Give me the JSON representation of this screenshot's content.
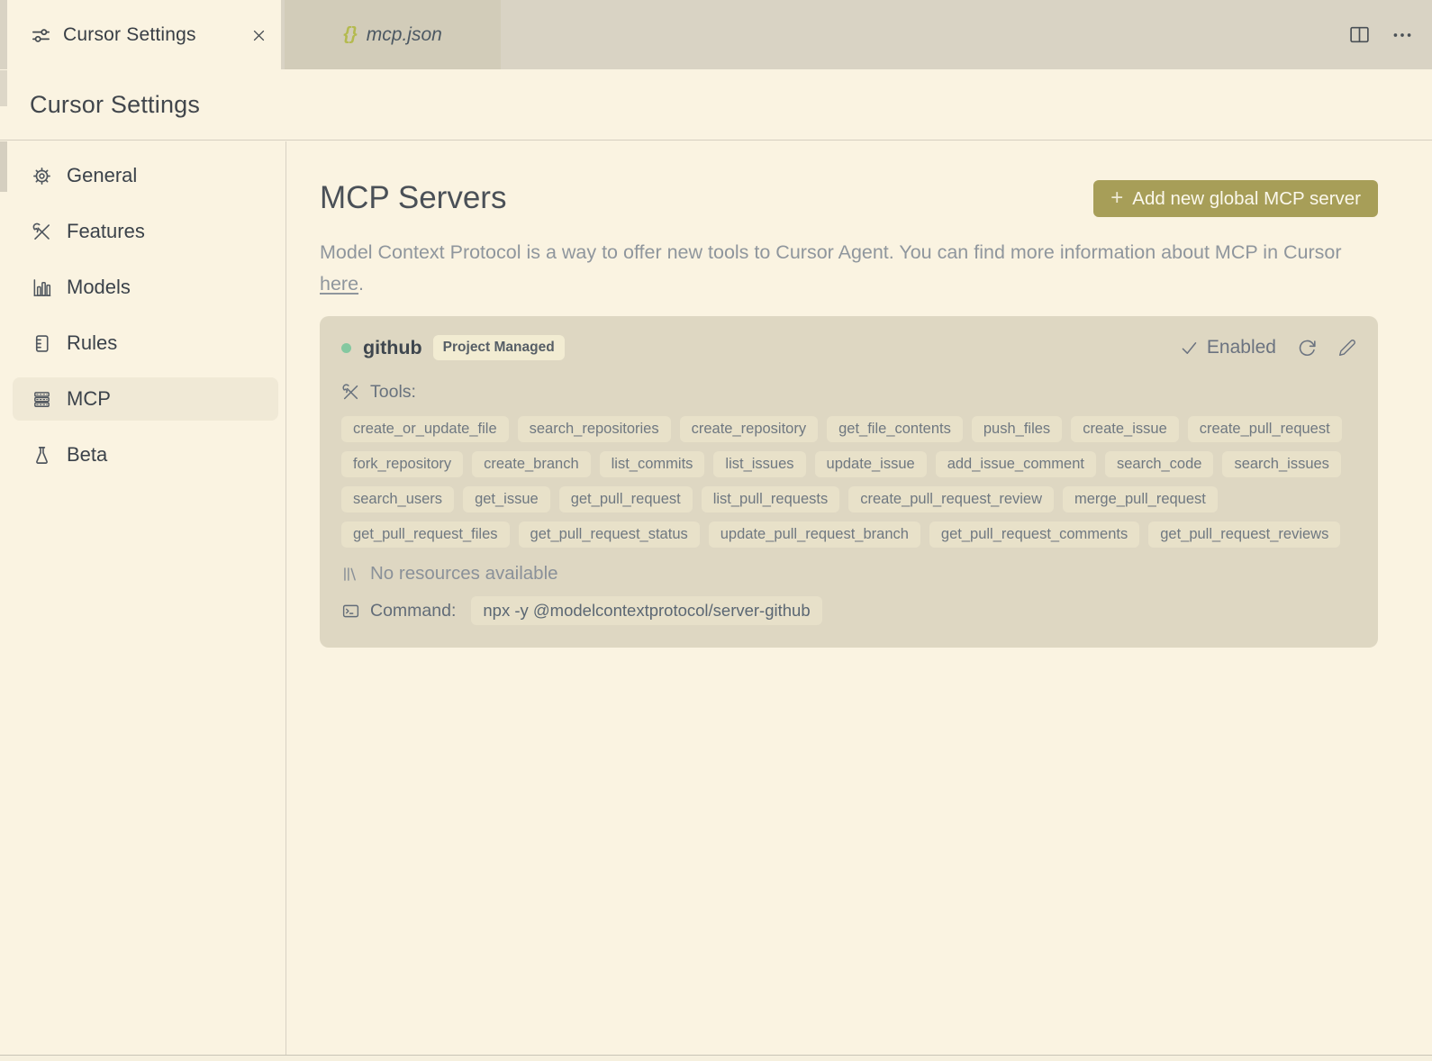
{
  "window": {
    "tabbar": {
      "active_tab": "Cursor Settings",
      "preview_tab": "mcp.json",
      "preview_tab_icon": "{}"
    }
  },
  "header": {
    "title": "Cursor Settings"
  },
  "sidebar": {
    "items": [
      {
        "label": "General",
        "icon": "gear-icon",
        "active": false
      },
      {
        "label": "Features",
        "icon": "tools-icon",
        "active": false
      },
      {
        "label": "Models",
        "icon": "bar-chart-icon",
        "active": false
      },
      {
        "label": "Rules",
        "icon": "ruler-icon",
        "active": false
      },
      {
        "label": "MCP",
        "icon": "server-stack-icon",
        "active": true
      },
      {
        "label": "Beta",
        "icon": "flask-icon",
        "active": false
      }
    ]
  },
  "main": {
    "title": "MCP Servers",
    "add_button": {
      "plus": "+",
      "label": "Add new global MCP server"
    },
    "description": {
      "before_link": "Model Context Protocol is a way to offer new tools to Cursor Agent. You can find more information about MCP in Cursor ",
      "link_label": "here",
      "after_link": "."
    },
    "server": {
      "name": "github",
      "badge": "Project Managed",
      "status_label": "Enabled",
      "tools_label": "Tools:",
      "tools": [
        "create_or_update_file",
        "search_repositories",
        "create_repository",
        "get_file_contents",
        "push_files",
        "create_issue",
        "create_pull_request",
        "fork_repository",
        "create_branch",
        "list_commits",
        "list_issues",
        "update_issue",
        "add_issue_comment",
        "search_code",
        "search_issues",
        "search_users",
        "get_issue",
        "get_pull_request",
        "list_pull_requests",
        "create_pull_request_review",
        "merge_pull_request",
        "get_pull_request_files",
        "get_pull_request_status",
        "update_pull_request_branch",
        "get_pull_request_comments",
        "get_pull_request_reviews"
      ],
      "resources_text": "No resources available",
      "command_label": "Command:",
      "command": "npx -y @modelcontextprotocol/server-github"
    }
  },
  "colors": {
    "accent_button": "#a79e58",
    "server_online_dot": "#84c8a0",
    "preview_tab_braces": "#b4ba4f",
    "page_background": "#faf3e1",
    "card_background": "#ded7c2"
  }
}
